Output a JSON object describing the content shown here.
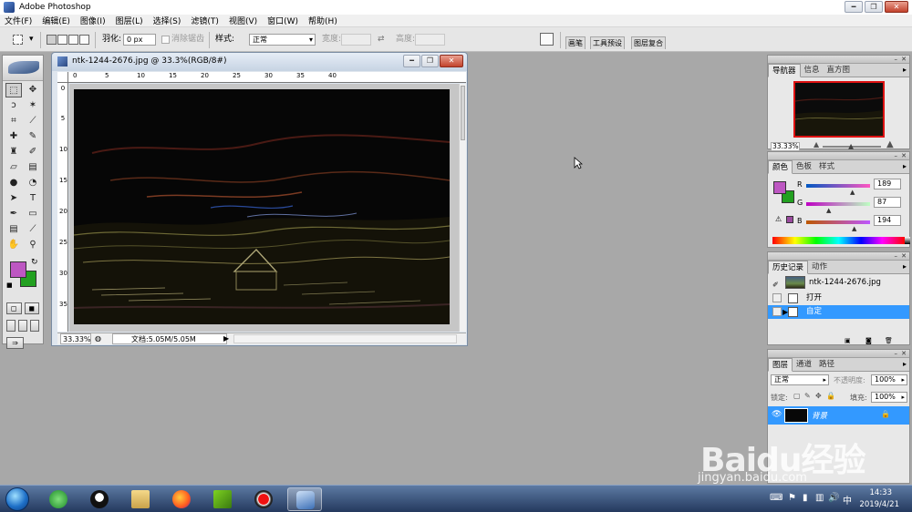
{
  "window": {
    "title": "Adobe Photoshop"
  },
  "menu": [
    "文件(F)",
    "编辑(E)",
    "图像(I)",
    "图层(L)",
    "选择(S)",
    "滤镜(T)",
    "视图(V)",
    "窗口(W)",
    "帮助(H)"
  ],
  "options": {
    "feather_label": "羽化:",
    "feather_value": "0 px",
    "antialias_label": "消除锯齿",
    "style_label": "样式:",
    "style_value": "正常",
    "width_label": "宽度:",
    "height_label": "高度:",
    "dock_tabs": [
      "画笔",
      "工具预设",
      "图层复合"
    ]
  },
  "document": {
    "title": "ntk-1244-2676.jpg @ 33.3%(RGB/8#)",
    "zoom": "33.33%",
    "doc_info": "文档:5.05M/5.05M",
    "ruler_h": [
      "0",
      "5",
      "10",
      "15",
      "20",
      "25",
      "30",
      "35",
      "40"
    ],
    "ruler_v": [
      "0",
      "5",
      "10",
      "15",
      "20",
      "25",
      "30",
      "35"
    ]
  },
  "navigator": {
    "tabs": [
      "导航器",
      "信息",
      "直方图"
    ],
    "zoom": "33.33%"
  },
  "color_panel": {
    "tabs": [
      "颜色",
      "色板",
      "样式"
    ],
    "r_label": "R",
    "g_label": "G",
    "b_label": "B",
    "r": "189",
    "g": "87",
    "b": "194",
    "foreground": "#bd57c2",
    "background": "#22a020"
  },
  "history": {
    "tabs": [
      "历史记录",
      "动作"
    ],
    "snapshot": "ntk-1244-2676.jpg",
    "items": [
      "打开",
      "自定"
    ]
  },
  "layers": {
    "tabs": [
      "图层",
      "通道",
      "路径"
    ],
    "blend": "正常",
    "opacity_label": "不透明度:",
    "opacity": "100%",
    "lock_label": "锁定:",
    "fill_label": "填充:",
    "fill": "100%",
    "layer_name": "背景"
  },
  "taskbar": {
    "time": "14:33",
    "date": "2019/4/21"
  },
  "watermark": {
    "logo": "Baidu经验",
    "url": "jingyan.baidu.com"
  }
}
